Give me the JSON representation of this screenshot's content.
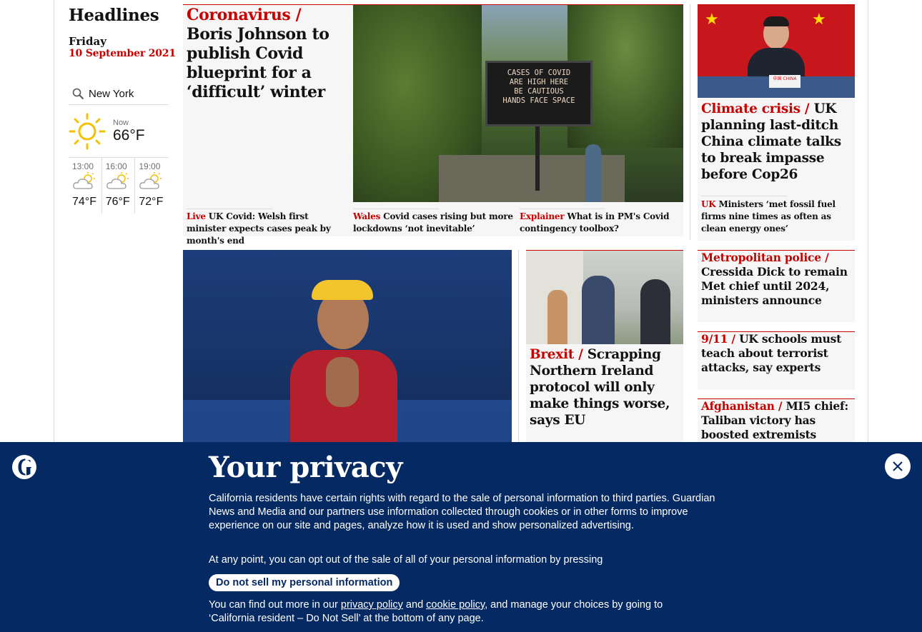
{
  "sidebar": {
    "title": "Headlines",
    "day": "Friday",
    "date": "10 September 2021"
  },
  "weather": {
    "location": "New York",
    "now_label": "Now",
    "now_temp": "66°F",
    "forecast": [
      {
        "time": "13:00",
        "temp": "74°F",
        "icon": "partly-cloudy-icon"
      },
      {
        "time": "16:00",
        "temp": "76°F",
        "icon": "partly-cloudy-icon"
      },
      {
        "time": "19:00",
        "temp": "72°F",
        "icon": "partly-cloudy-icon"
      }
    ],
    "now_icon": "sun-icon"
  },
  "stories": {
    "lead": {
      "kicker": "Coronavirus /",
      "headline": "Boris Johnson to publish Covid blueprint for a ‘difficult’ winter",
      "image_sign_lines": [
        "CASES OF COVID",
        "ARE HIGH HERE",
        "BE CAUTIOUS",
        "HANDS FACE SPACE"
      ],
      "sublinks": [
        {
          "kicker": "Live",
          "text": "UK Covid: Welsh first minister expects cases peak by month's end"
        },
        {
          "kicker": "Wales",
          "text": "Covid cases rising but more lockdowns ‘not inevitable’"
        },
        {
          "kicker": "Explainer",
          "text": "What is in PM's Covid contingency toolbox?"
        }
      ]
    },
    "climate": {
      "kicker": "Climate crisis /",
      "headline": "UK planning last-ditch China climate talks to break impasse before Cop26",
      "image_caption": "中国 CHINA",
      "sublink_kicker": "UK",
      "sublink_text": "Ministers ‘met fossil fuel firms nine times as often as clean energy ones’"
    },
    "brexit": {
      "kicker": "Brexit /",
      "headline": "Scrapping Northern Ireland protocol will only make things worse, says EU"
    },
    "met": {
      "kicker": "Metropolitan police /",
      "headline": "Cressida Dick to remain Met chief until 2024, ministers announce"
    },
    "schools": {
      "kicker": "9/11 /",
      "headline": "UK schools must teach about terrorist attacks, say experts"
    },
    "afghanistan": {
      "kicker": "Afghanistan /",
      "headline": "MI5 chief: Taliban victory has boosted extremists"
    }
  },
  "privacy": {
    "title": "Your privacy",
    "paragraph1": "California residents have certain rights with regard to the sale of personal information to third parties. Guardian News and Media and our partners use information collected through cookies or in other forms to improve experience on our site and pages, analyze how it is used and show personalized advertising.",
    "paragraph2": "At any point, you can opt out of the sale of all of your personal information by pressing",
    "button": "Do not sell my personal information",
    "p3_before": "You can find out more in our ",
    "p3_link1": "privacy policy",
    "p3_mid": " and ",
    "p3_link2": "cookie policy",
    "p3_after": ", and manage your choices by going to ‘California resident – Do Not Sell’ at the bottom of any page."
  },
  "colors": {
    "accent_red": "#c70000",
    "brand_blue": "#052962",
    "card_bg": "#f6f6f6"
  }
}
